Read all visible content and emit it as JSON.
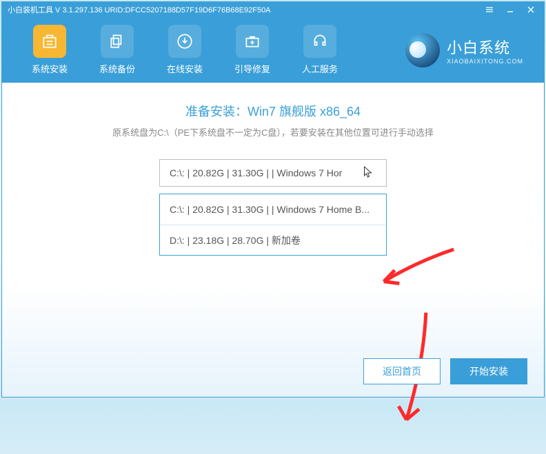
{
  "titlebar": {
    "text": "小白装机工具 V 3.1.297.136 URID:DFCC5207188D57F19D6F76B68E92F50A"
  },
  "nav": {
    "items": [
      {
        "label": "系统安装",
        "icon": "box-icon",
        "active": true
      },
      {
        "label": "系统备份",
        "icon": "copy-icon",
        "active": false
      },
      {
        "label": "在线安装",
        "icon": "download-icon",
        "active": false
      },
      {
        "label": "引导修复",
        "icon": "medkit-icon",
        "active": false
      },
      {
        "label": "人工服务",
        "icon": "headset-icon",
        "active": false
      }
    ]
  },
  "brand": {
    "title": "小白系统",
    "sub": "XIAOBAIXITONG.COM"
  },
  "content": {
    "title": "准备安装：Win7 旗舰版 x86_64",
    "hint": "原系统盘为C:\\（PE下系统盘不一定为C盘），若要安装在其他位置可进行手动选择",
    "selected": "C:\\: | 20.82G | 31.30G |  | Windows 7 Hor",
    "options": [
      "C:\\: | 20.82G | 31.30G |  | Windows 7 Home B...",
      "D:\\: | 23.18G | 28.70G | 新加卷"
    ]
  },
  "footer": {
    "back": "返回首页",
    "start": "开始安装"
  },
  "colors": {
    "primary": "#3a9fd8",
    "accent": "#f7b733",
    "arrow": "#ff2a2a"
  }
}
